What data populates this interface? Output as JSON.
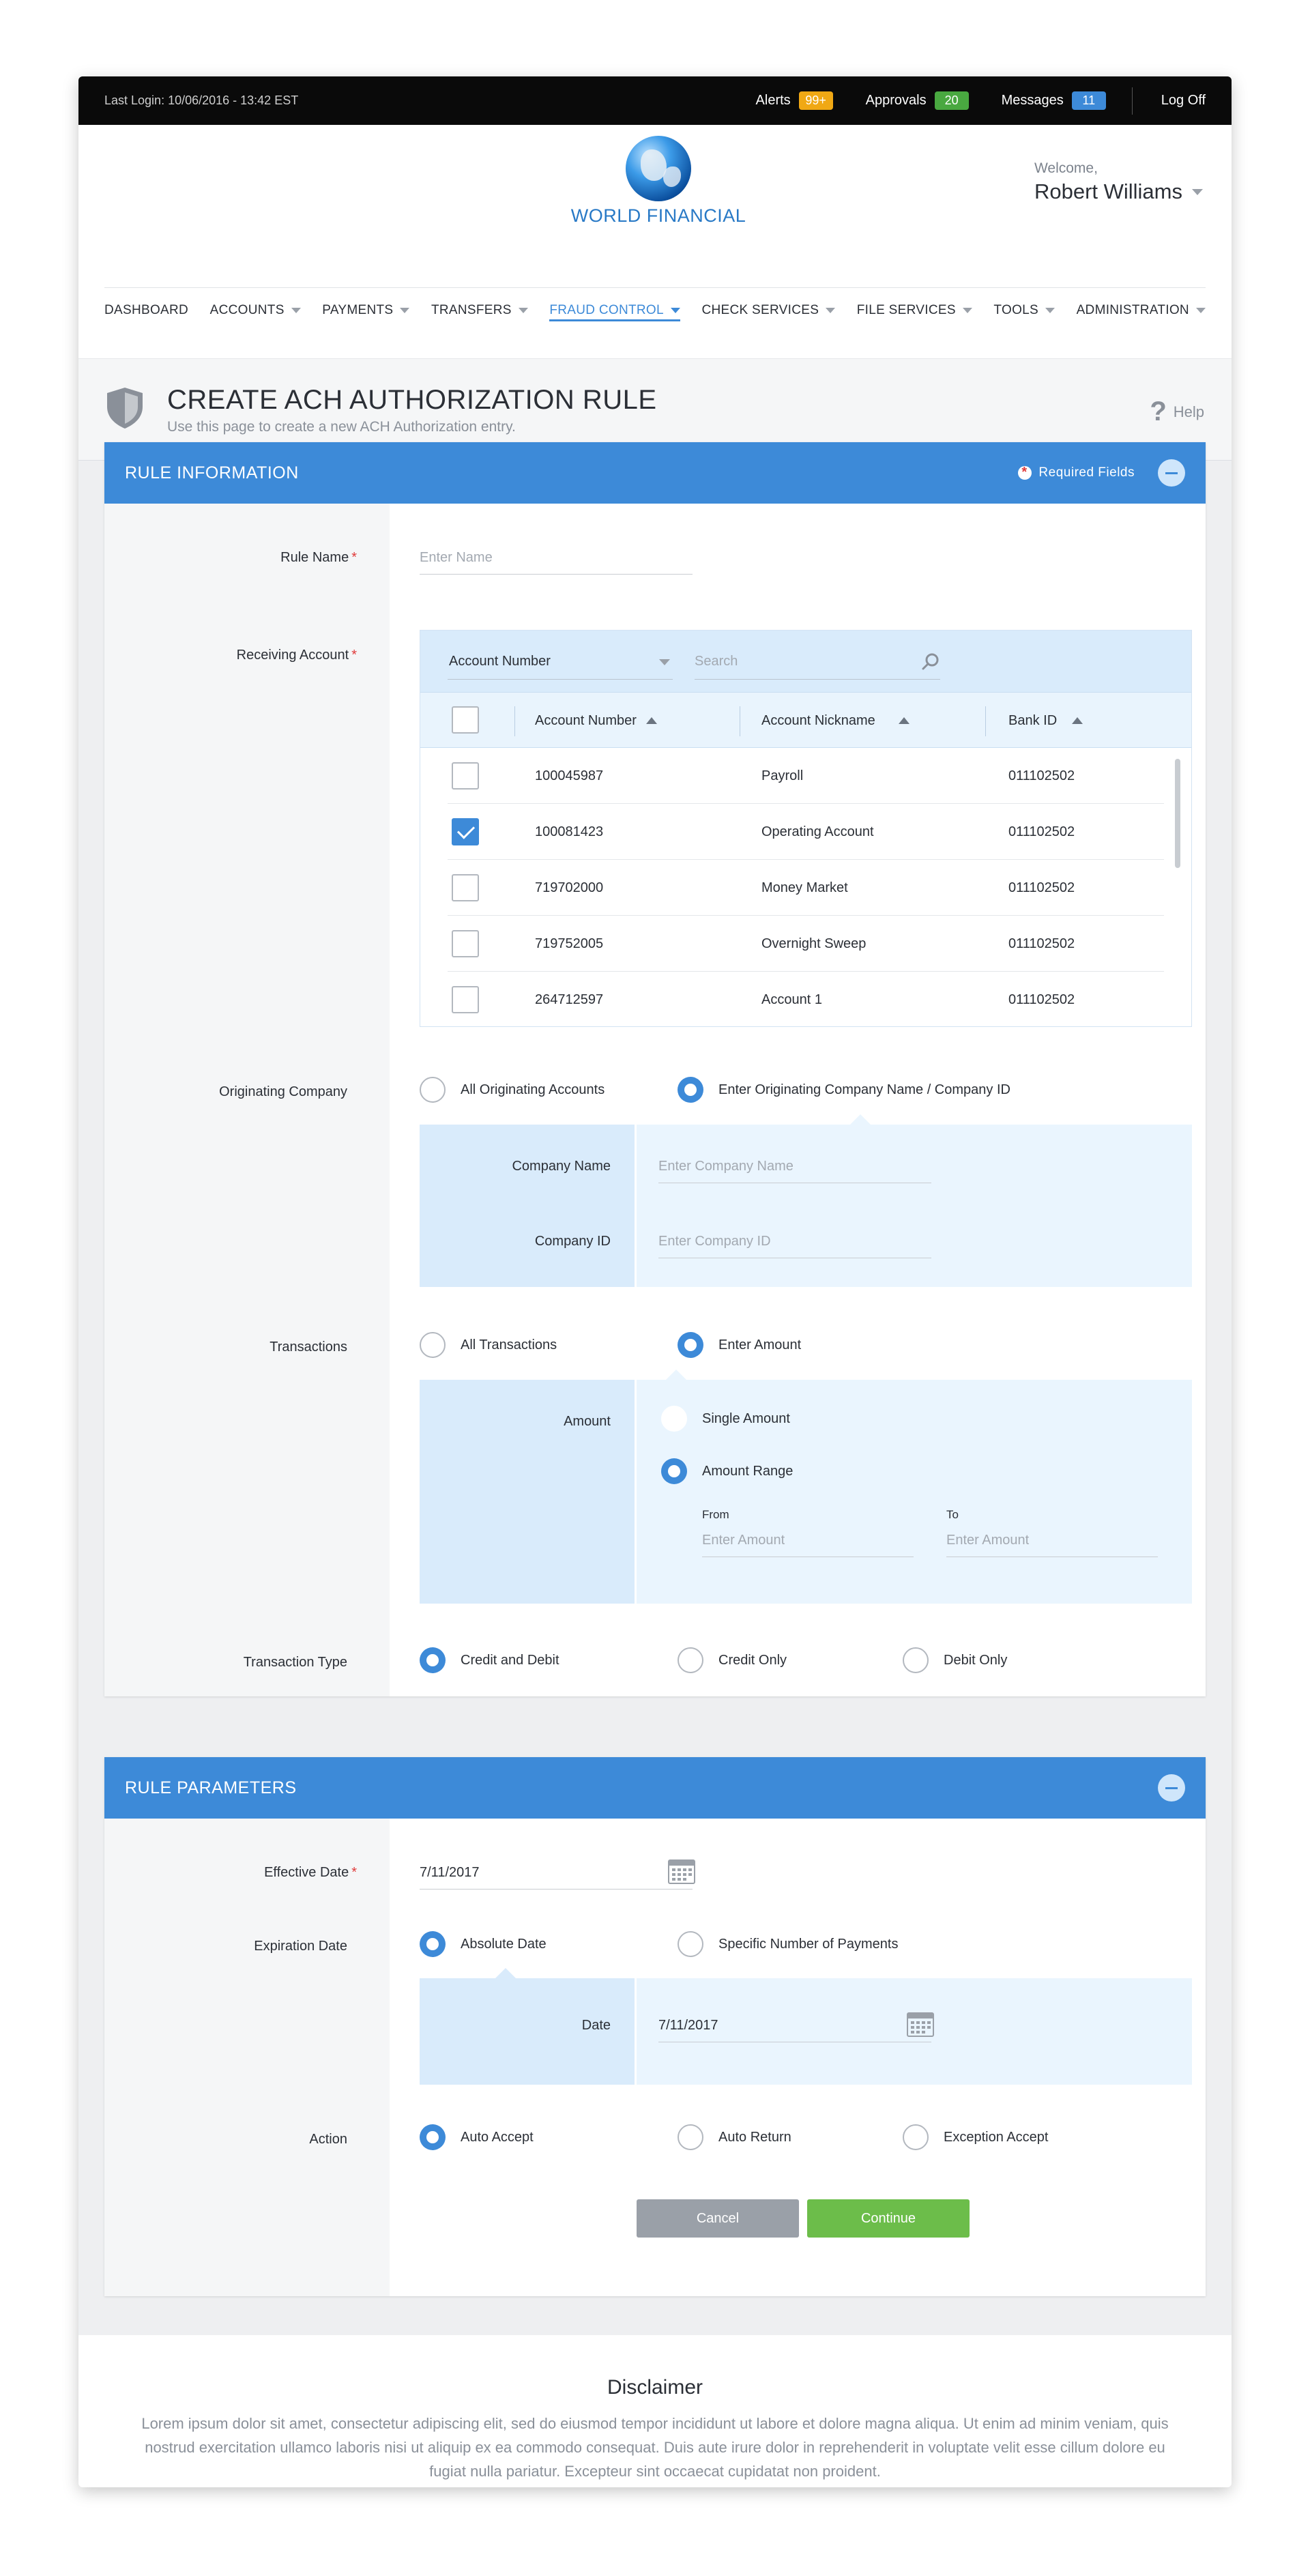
{
  "topbar": {
    "last_login": "Last Login: 10/06/2016 - 13:42 EST",
    "alerts_label": "Alerts",
    "alerts_count": "99+",
    "approvals_label": "Approvals",
    "approvals_count": "20",
    "messages_label": "Messages",
    "messages_count": "11",
    "logoff_label": "Log Off"
  },
  "header": {
    "logo_text": "WORLD FINANCIAL",
    "welcome": "Welcome,",
    "user_name": "Robert Williams"
  },
  "nav": [
    {
      "label": "DASHBOARD",
      "dropdown": false
    },
    {
      "label": "ACCOUNTS",
      "dropdown": true
    },
    {
      "label": "PAYMENTS",
      "dropdown": true
    },
    {
      "label": "TRANSFERS",
      "dropdown": true
    },
    {
      "label": "FRAUD CONTROL",
      "dropdown": true,
      "active": true
    },
    {
      "label": "CHECK SERVICES",
      "dropdown": true
    },
    {
      "label": "FILE SERVICES",
      "dropdown": true
    },
    {
      "label": "TOOLS",
      "dropdown": true
    },
    {
      "label": "ADMINISTRATION",
      "dropdown": true
    }
  ],
  "page": {
    "title": "CREATE ACH AUTHORIZATION RULE",
    "subtitle": "Use this page to create a new ACH Authorization entry.",
    "help": "Help"
  },
  "rule_info": {
    "heading": "RULE INFORMATION",
    "required_fields": "Required Fields",
    "rule_name_label": "Rule Name",
    "rule_name_placeholder": "Enter Name",
    "receiving_account_label": "Receiving Account",
    "filter_select": "Account Number",
    "search_placeholder": "Search",
    "columns": [
      "Account Number",
      "Account Nickname",
      "Bank ID"
    ],
    "rows": [
      {
        "number": "100045987",
        "nickname": "Payroll",
        "bank": "011102502",
        "checked": false
      },
      {
        "number": "100081423",
        "nickname": "Operating Account",
        "bank": "011102502",
        "checked": true
      },
      {
        "number": "719702000",
        "nickname": "Money Market",
        "bank": "011102502",
        "checked": false
      },
      {
        "number": "719752005",
        "nickname": "Overnight Sweep",
        "bank": "011102502",
        "checked": false
      },
      {
        "number": "264712597",
        "nickname": "Account 1",
        "bank": "011102502",
        "checked": false
      }
    ],
    "orig_company_label": "Originating Company",
    "orig_all": "All Originating Accounts",
    "orig_enter": "Enter Originating Company Name / Company ID",
    "company_name_label": "Company Name",
    "company_name_placeholder": "Enter Company Name",
    "company_id_label": "Company ID",
    "company_id_placeholder": "Enter Company ID",
    "transactions_label": "Transactions",
    "tx_all": "All Transactions",
    "tx_enter": "Enter Amount",
    "amount_label": "Amount",
    "single_amount": "Single Amount",
    "amount_range": "Amount Range",
    "from_label": "From",
    "to_label": "To",
    "amount_placeholder": "Enter Amount",
    "tx_type_label": "Transaction Type",
    "tx_type_options": [
      "Credit and Debit",
      "Credit Only",
      "Debit Only"
    ]
  },
  "rule_params": {
    "heading": "RULE PARAMETERS",
    "effective_date_label": "Effective Date",
    "effective_date_value": "7/11/2017",
    "expiration_label": "Expiration Date",
    "exp_absolute": "Absolute Date",
    "exp_specific": "Specific Number of Payments",
    "date_label": "Date",
    "date_value": "7/11/2017",
    "action_label": "Action",
    "action_options": [
      "Auto Accept",
      "Auto Return",
      "Exception Accept"
    ],
    "cancel": "Cancel",
    "continue": "Continue"
  },
  "disclaimer": {
    "title": "Disclaimer",
    "text": "Lorem ipsum dolor sit amet, consectetur adipiscing elit, sed do eiusmod tempor incididunt ut labore et dolore magna aliqua. Ut enim ad minim veniam, quis nostrud exercitation ullamco laboris nisi ut aliquip ex ea commodo consequat. Duis aute irure dolor in reprehenderit in voluptate velit esse cillum dolore eu fugiat nulla pariatur. Excepteur sint occaecat cupidatat non proident."
  },
  "colors": {
    "primary": "#3d8ad8",
    "success": "#6cbd4a",
    "required": "#e03a3a"
  }
}
